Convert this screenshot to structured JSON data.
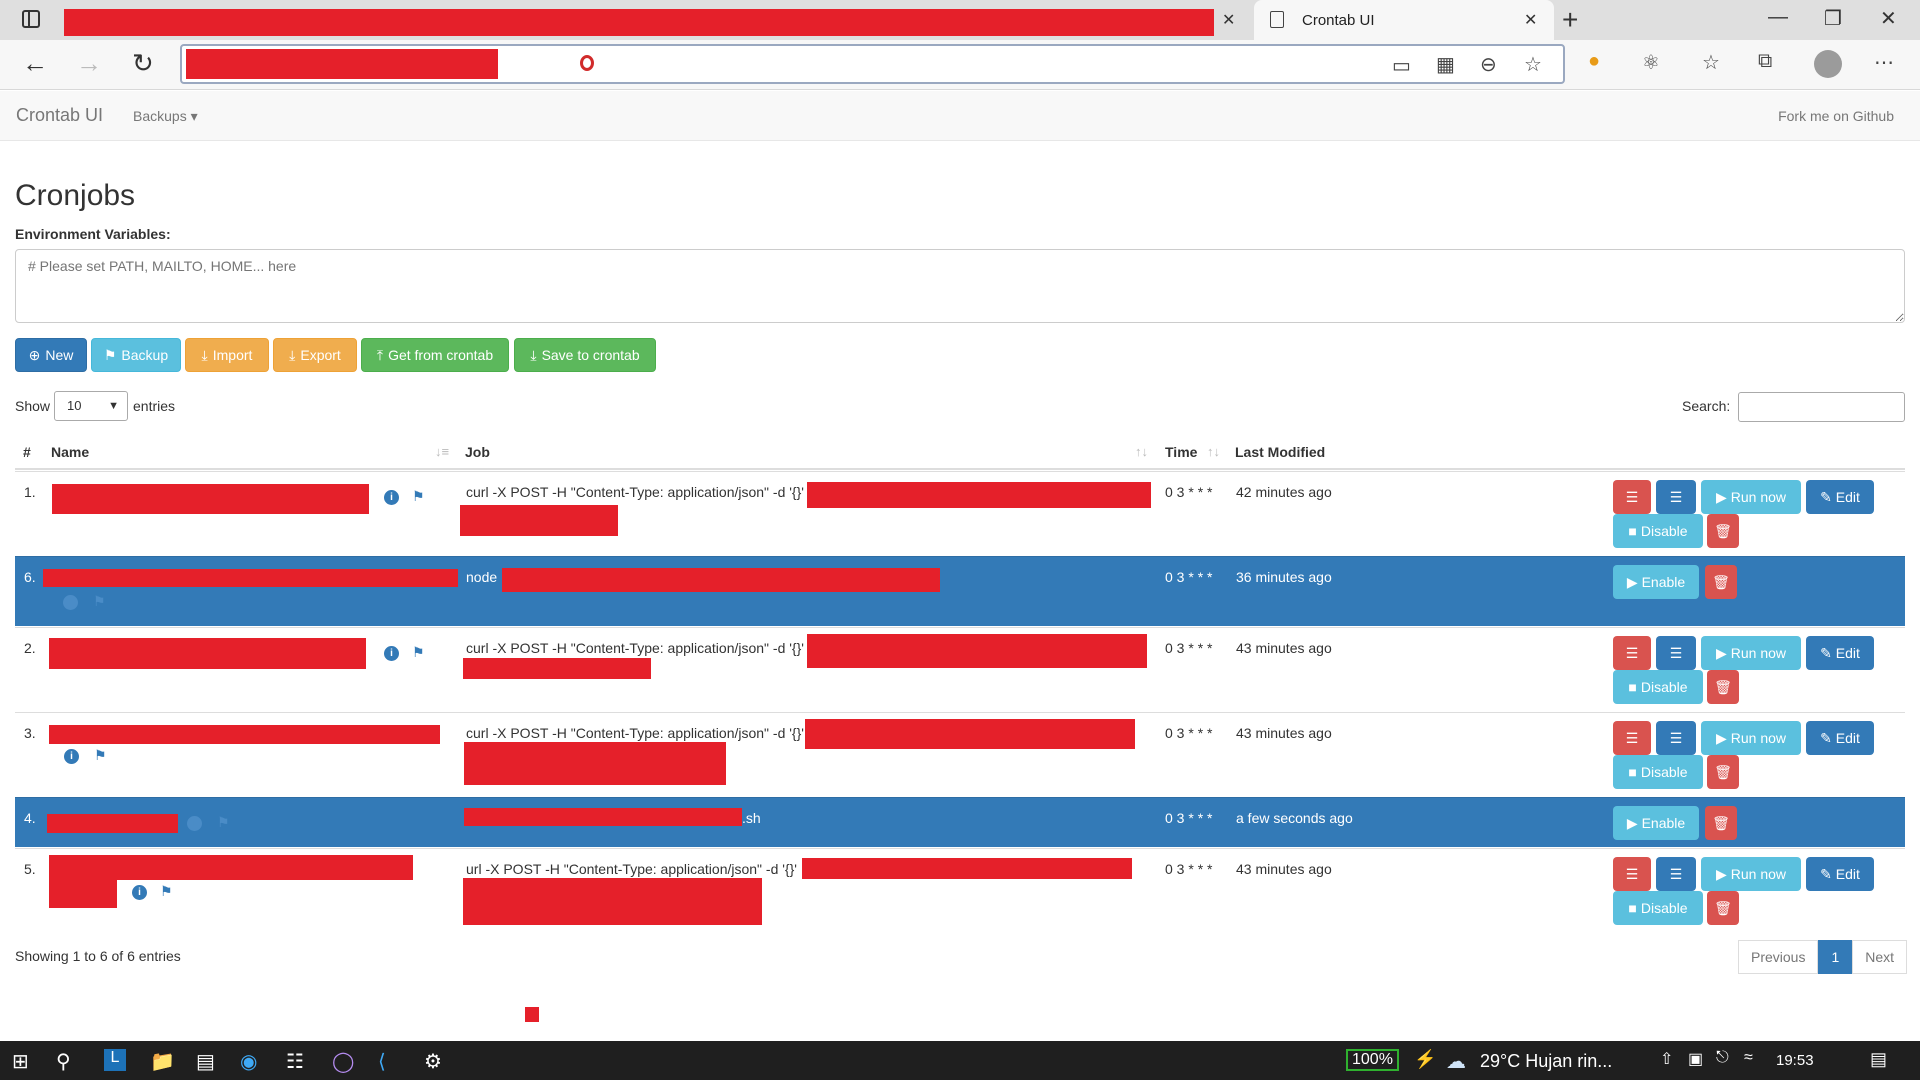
{
  "browser": {
    "active_tab_title": "Crontab UI",
    "new_tab_symbol": "+",
    "close_symbol": "✕"
  },
  "app": {
    "brand": "Crontab UI",
    "backups_menu": "Backups ▾",
    "fork_link": "Fork me on Github"
  },
  "page": {
    "title": "Cronjobs",
    "env_label": "Environment Variables:",
    "env_placeholder": "# Please set PATH, MAILTO, HOME... here"
  },
  "buttons": {
    "new": "New",
    "backup": "Backup",
    "import": "Import",
    "export": "Export",
    "get_from_crontab": "Get from crontab",
    "save_to_crontab": "Save to crontab"
  },
  "table_controls": {
    "show": "Show",
    "entries_value": "10",
    "entries": "entries",
    "search": "Search:"
  },
  "columns": {
    "num": "#",
    "name": "Name",
    "job": "Job",
    "time": "Time",
    "modified": "Last Modified"
  },
  "rows": [
    {
      "num": "1.",
      "job": "curl -X POST -H \"Content-Type: application/json\" -d '{}'",
      "time": "0 3 * * *",
      "modified": "42 minutes ago",
      "enabled": true
    },
    {
      "num": "6.",
      "job": "node",
      "time": "0 3 * * *",
      "modified": "36 minutes ago",
      "enabled": false
    },
    {
      "num": "2.",
      "job": "curl -X POST -H \"Content-Type: application/json\" -d '{}'",
      "time": "0 3 * * *",
      "modified": "43 minutes ago",
      "enabled": true
    },
    {
      "num": "3.",
      "job": "curl -X POST -H \"Content-Type: application/json\" -d '{}'",
      "time": "0 3 * * *",
      "modified": "43 minutes ago",
      "enabled": true
    },
    {
      "num": "4.",
      "job": ".sh",
      "time": "0 3 * * *",
      "modified": "a few seconds ago",
      "enabled": false
    },
    {
      "num": "5.",
      "job": "url -X POST -H \"Content-Type: application/json\" -d '{}'",
      "time": "0 3 * * *",
      "modified": "43 minutes ago",
      "enabled": true
    }
  ],
  "row_actions": {
    "run_now": "Run now",
    "edit": "Edit",
    "disable": "Disable",
    "enable": "Enable"
  },
  "footer": {
    "info": "Showing 1 to 6 of 6 entries",
    "previous": "Previous",
    "page": "1",
    "next": "Next"
  },
  "taskbar": {
    "battery": "100%",
    "weather": "29°C  Hujan rin...",
    "clock": "19:53"
  },
  "colors": {
    "primary": "#337ab7",
    "info": "#5bc0de",
    "warning": "#f0ad4e",
    "success": "#5cb85c",
    "danger": "#d9534f",
    "redaction": "#e5202a"
  }
}
